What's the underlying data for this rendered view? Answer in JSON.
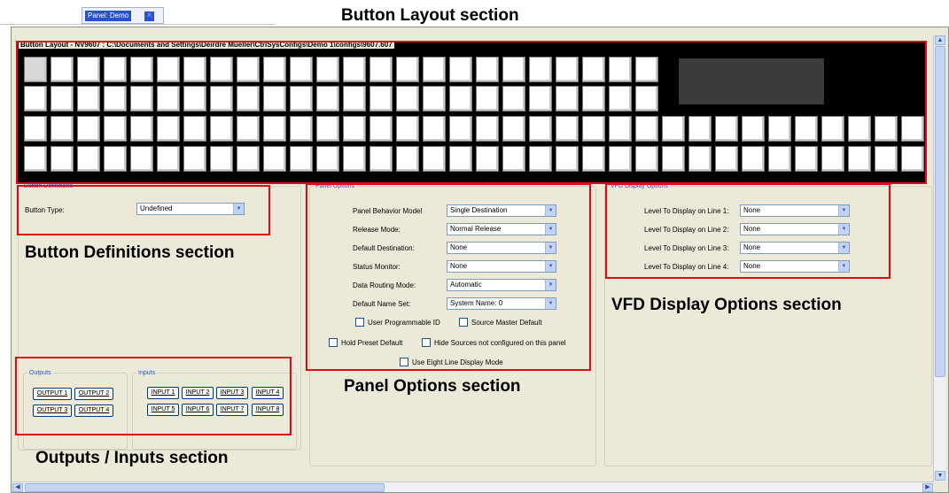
{
  "tab": {
    "label": "Panel: Demo",
    "close": "×"
  },
  "annotations": {
    "button_layout": "Button Layout section",
    "button_definitions": "Button Definitions section",
    "panel_options": "Panel Options section",
    "vfd_display": "VFD Display Options section",
    "outputs_inputs": "Outputs / Inputs section"
  },
  "button_layout": {
    "title": "Button Layout - NV9607 : C:\\Documents and Settings\\Deirdre Mueller\\CtrlSysConfigs\\Demo 1\\configs\\9607.607",
    "rows": [
      24,
      24,
      34,
      34
    ],
    "selected_index": 0
  },
  "button_definitions": {
    "legend": "Button Definitions",
    "type_label": "Button Type:",
    "type_value": "Undefined"
  },
  "panel_options": {
    "legend": "Panel Options",
    "fields": [
      {
        "label": "Panel Behavior Model",
        "value": "Single Destination"
      },
      {
        "label": "Release Mode:",
        "value": "Normal Release"
      },
      {
        "label": "Default Destination:",
        "value": "None"
      },
      {
        "label": "Status Monitor:",
        "value": "None"
      },
      {
        "label": "Data Routing Mode:",
        "value": "Automatic"
      },
      {
        "label": "Default Name Set:",
        "value": "System Name: 0"
      }
    ],
    "checkboxes": [
      {
        "label": "User Programmable ID",
        "checked": false
      },
      {
        "label": "Source Master Default",
        "checked": false
      },
      {
        "label": "Hold Preset Default",
        "checked": false
      },
      {
        "label": "Hide Sources not configured on this panel",
        "checked": false
      },
      {
        "label": "Use Eight Line Display Mode",
        "checked": false
      }
    ]
  },
  "vfd_options": {
    "legend": "VFD Display Options",
    "fields": [
      {
        "label": "Level To Display on Line 1:",
        "value": "None"
      },
      {
        "label": "Level To Display on Line 2:",
        "value": "None"
      },
      {
        "label": "Level To Display on Line 3:",
        "value": "None"
      },
      {
        "label": "Level To Display on Line 4:",
        "value": "None"
      }
    ]
  },
  "outputs": {
    "legend": "Outputs",
    "buttons": [
      "OUTPUT 1",
      "OUTPUT 2",
      "OUTPUT 3",
      "OUTPUT 4"
    ]
  },
  "inputs": {
    "legend": "Inputs",
    "buttons": [
      "INPUT 1",
      "INPUT 2",
      "INPUT 3",
      "INPUT 4",
      "INPUT 5",
      "INPUT 6",
      "INPUT 7",
      "INPUT 8"
    ]
  },
  "icons": {
    "dropdown": "chevron-down-icon",
    "scroll_up": "arrow-up-icon",
    "scroll_down": "arrow-down-icon",
    "scroll_left": "arrow-left-icon",
    "scroll_right": "arrow-right-icon"
  },
  "colors": {
    "highlight": "#e30613",
    "legend": "#2255cc",
    "tab": "#2950d0"
  }
}
